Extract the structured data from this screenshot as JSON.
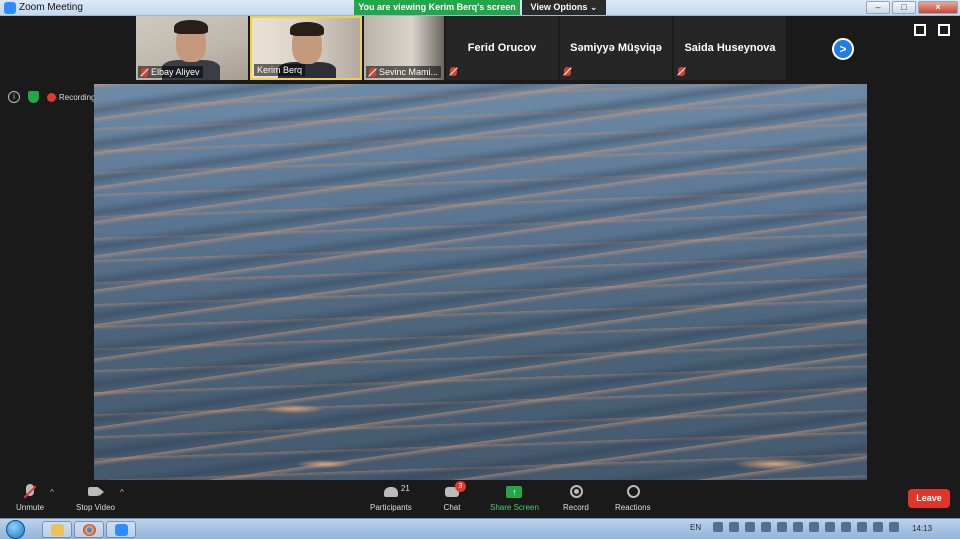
{
  "window": {
    "title": "Zoom Meeting",
    "buttons": {
      "minimize": "–",
      "maximize": "□",
      "close": "×"
    }
  },
  "banner": {
    "viewing": "You are viewing Kerim Berq's screen",
    "view_options": "View Options ⌄"
  },
  "participants_strip": [
    {
      "name": "Elbay Aliyev",
      "has_video": true,
      "muted": true
    },
    {
      "name": "Kerim Berq",
      "has_video": true,
      "muted": false,
      "active_speaker": true
    },
    {
      "name": "Sevinc Mami...",
      "has_video": true,
      "muted": true
    },
    {
      "name": "Ferid Orucov",
      "has_video": false,
      "muted": true
    },
    {
      "name": "Səmiyyə Müşviqə",
      "has_video": false,
      "muted": true
    },
    {
      "name": "Saida Huseynova",
      "has_video": false,
      "muted": true
    }
  ],
  "strip_next": ">",
  "status": {
    "info": "i",
    "recording": "Recording"
  },
  "toolbar": {
    "unmute": "Unmute",
    "stop_video": "Stop Video",
    "participants": "Participants",
    "participants_count": "21",
    "chat": "Chat",
    "chat_badge": "3",
    "share_screen": "Share Screen",
    "record": "Record",
    "reactions": "Reactions",
    "leave": "Leave",
    "caret": "^"
  },
  "taskbar": {
    "language": "EN",
    "time": "14:13"
  },
  "colors": {
    "accent_green": "#22a64a",
    "leave_red": "#e0362a",
    "zoom_blue": "#2d8cff"
  }
}
